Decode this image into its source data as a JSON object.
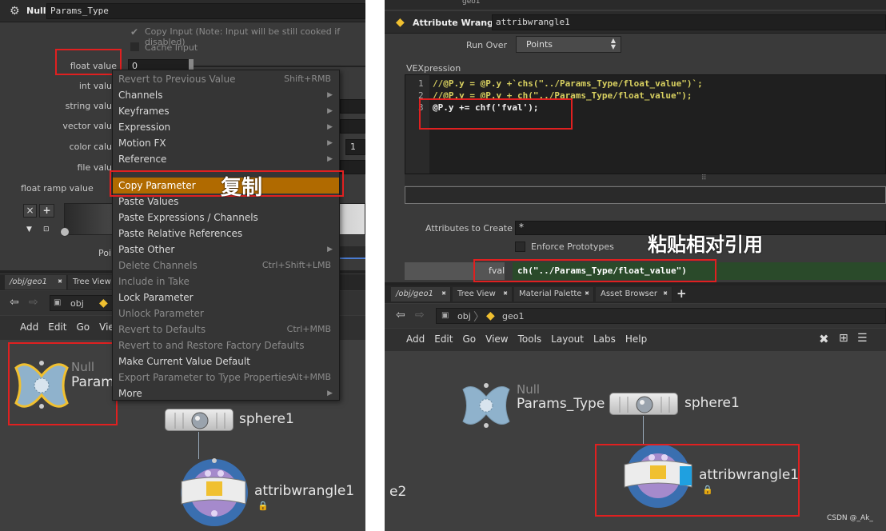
{
  "left": {
    "header": {
      "node_type": "Null",
      "node_name": "Params_Type"
    },
    "checks": {
      "copy_input": "Copy Input (Note: Input will be still cooked if disabled)",
      "cache_input": "Cache Input"
    },
    "params": {
      "float_value": "float value",
      "float_value_val": "0",
      "int_value": "int valu",
      "string_value": "string valu",
      "vector_value": "vector valu",
      "color_value": "color calu",
      "file_value": "file valu",
      "float_ramp": "float ramp value",
      "point_label": "Poi",
      "color_field_val": "1"
    },
    "context_menu": [
      {
        "label": "Revert to Previous Value",
        "shortcut": "Shift+RMB",
        "disabled": true
      },
      {
        "label": "Channels",
        "submenu": true
      },
      {
        "label": "Keyframes",
        "submenu": true
      },
      {
        "label": "Expression",
        "submenu": true
      },
      {
        "label": "Motion FX",
        "submenu": true
      },
      {
        "label": "Reference",
        "submenu": true
      },
      {
        "label": "Copy Parameter",
        "highlight": true
      },
      {
        "label": "Paste Values"
      },
      {
        "label": "Paste Expressions / Channels"
      },
      {
        "label": "Paste Relative References"
      },
      {
        "label": "Paste Other",
        "submenu": true
      },
      {
        "label": "Delete Channels",
        "shortcut": "Ctrl+Shift+LMB",
        "disabled": true
      },
      {
        "label": "Include in Take",
        "disabled": true
      },
      {
        "label": "Lock Parameter"
      },
      {
        "label": "Unlock Parameter",
        "disabled": true
      },
      {
        "label": "Revert to Defaults",
        "shortcut": "Ctrl+MMB",
        "disabled": true
      },
      {
        "label": "Revert to and Restore Factory Defaults",
        "disabled": true
      },
      {
        "label": "Make Current Value Default"
      },
      {
        "label": "Export Parameter to Type Properties",
        "shortcut": "Alt+MMB",
        "disabled": true
      },
      {
        "label": "More",
        "submenu": true
      }
    ],
    "copy_annotation": "复制",
    "tabs": [
      "/obj/geo1",
      "Tree View"
    ],
    "path": "obj",
    "menubar": [
      "Add",
      "Edit",
      "Go",
      "Vie"
    ],
    "nodes": {
      "null_type": "Null",
      "null_name": "Param",
      "sphere": "sphere1",
      "wrangle": "attribwrangle1"
    }
  },
  "right": {
    "header": {
      "node_type": "Attribute Wrangle",
      "node_name": "attribwrangle1"
    },
    "top_label": "geo1",
    "run_over_label": "Run Over",
    "run_over_value": "Points",
    "vex_label": "VEXpression",
    "code_lines": [
      {
        "num": "1",
        "text": "//@P.y = @P.y +`chs(\"../Params_Type/float_value\")`;"
      },
      {
        "num": "2",
        "text": "//@P.y = @P.y + ch(\"../Params_Type/float_value\");"
      },
      {
        "num": "3",
        "text": "@P.y += chf('fval');"
      }
    ],
    "attrs_label": "Attributes to Create",
    "attrs_value": "*",
    "enforce": "Enforce Prototypes",
    "paste_annotation": "粘贴相对引用",
    "fval_label": "fval",
    "fval_value": "ch(\"../Params_Type/float_value\")",
    "tabs": [
      "/obj/geo1",
      "Tree View",
      "Material Palette",
      "Asset Browser"
    ],
    "path": [
      "obj",
      "geo1"
    ],
    "menubar": [
      "Add",
      "Edit",
      "Go",
      "View",
      "Tools",
      "Layout",
      "Labs",
      "Help"
    ],
    "nodes": {
      "null_type": "Null",
      "null_name": "Params_Type",
      "sphere": "sphere1",
      "wrangle": "attribwrangle1",
      "partial": "e2"
    },
    "watermark": "CSDN @_Ak_"
  }
}
